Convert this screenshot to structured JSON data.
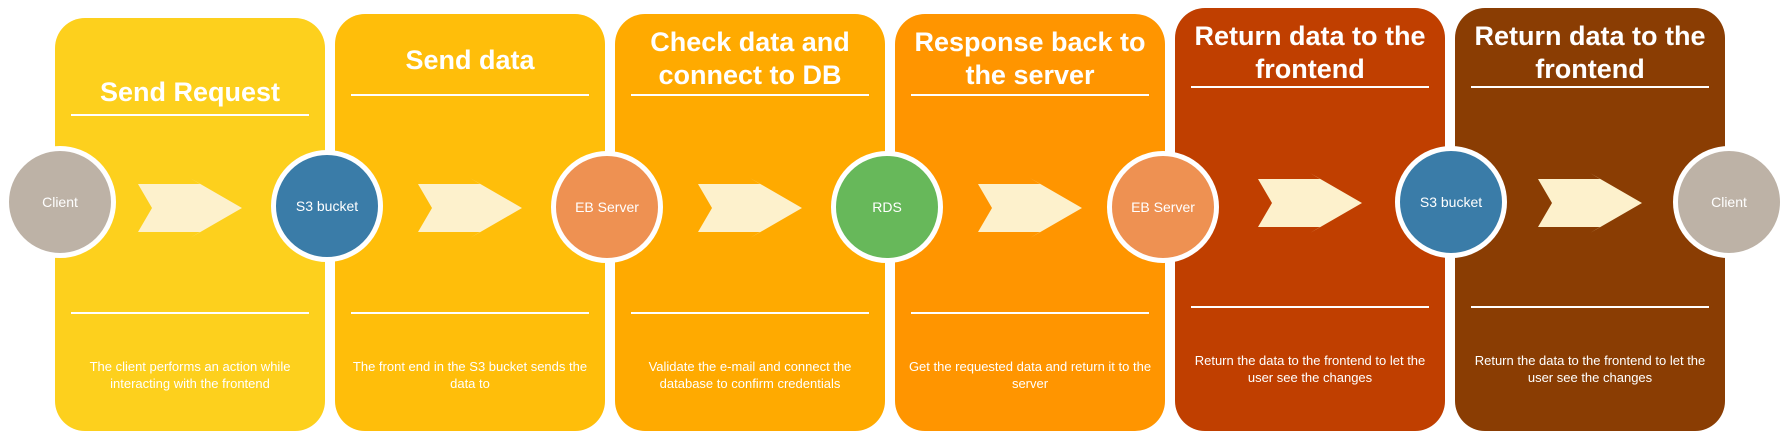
{
  "steps": [
    {
      "title": "Send Request",
      "description": "The client performs an action while interacting with the frontend",
      "color": "#fdd01d"
    },
    {
      "title": "Send data",
      "description": "The front end in the S3 bucket sends the data to",
      "color": "#ffbe0a"
    },
    {
      "title": "Check data and connect to DB",
      "description": "Validate the e-mail and connect the database to confirm credentials",
      "color": "#ffaa00"
    },
    {
      "title": "Response back to the server",
      "description": "Get the requested data and return it to the server",
      "color": "#ff9500"
    },
    {
      "title": "Return data to the frontend",
      "description": "Return the data to the frontend to let the user see the changes",
      "color": "#c03f00"
    },
    {
      "title": "Return data to the frontend",
      "description": "Return the data to the frontend to let the user see the changes",
      "color": "#8a3d03"
    }
  ],
  "nodes": [
    {
      "label": "Client",
      "color": "#bdb2a6"
    },
    {
      "label": "S3 bucket",
      "color": "#3a7ca8"
    },
    {
      "label": "EB Server",
      "color": "#ee9152"
    },
    {
      "label": "RDS",
      "color": "#67b85a"
    },
    {
      "label": "EB Server",
      "color": "#ee9152"
    },
    {
      "label": "S3 bucket",
      "color": "#3a7ca8"
    },
    {
      "label": "Client",
      "color": "#bdb2a6"
    }
  ],
  "arrow_color": "#fdf1cc",
  "title_line_1": "Check data and",
  "title_line_2": "connect to DB"
}
